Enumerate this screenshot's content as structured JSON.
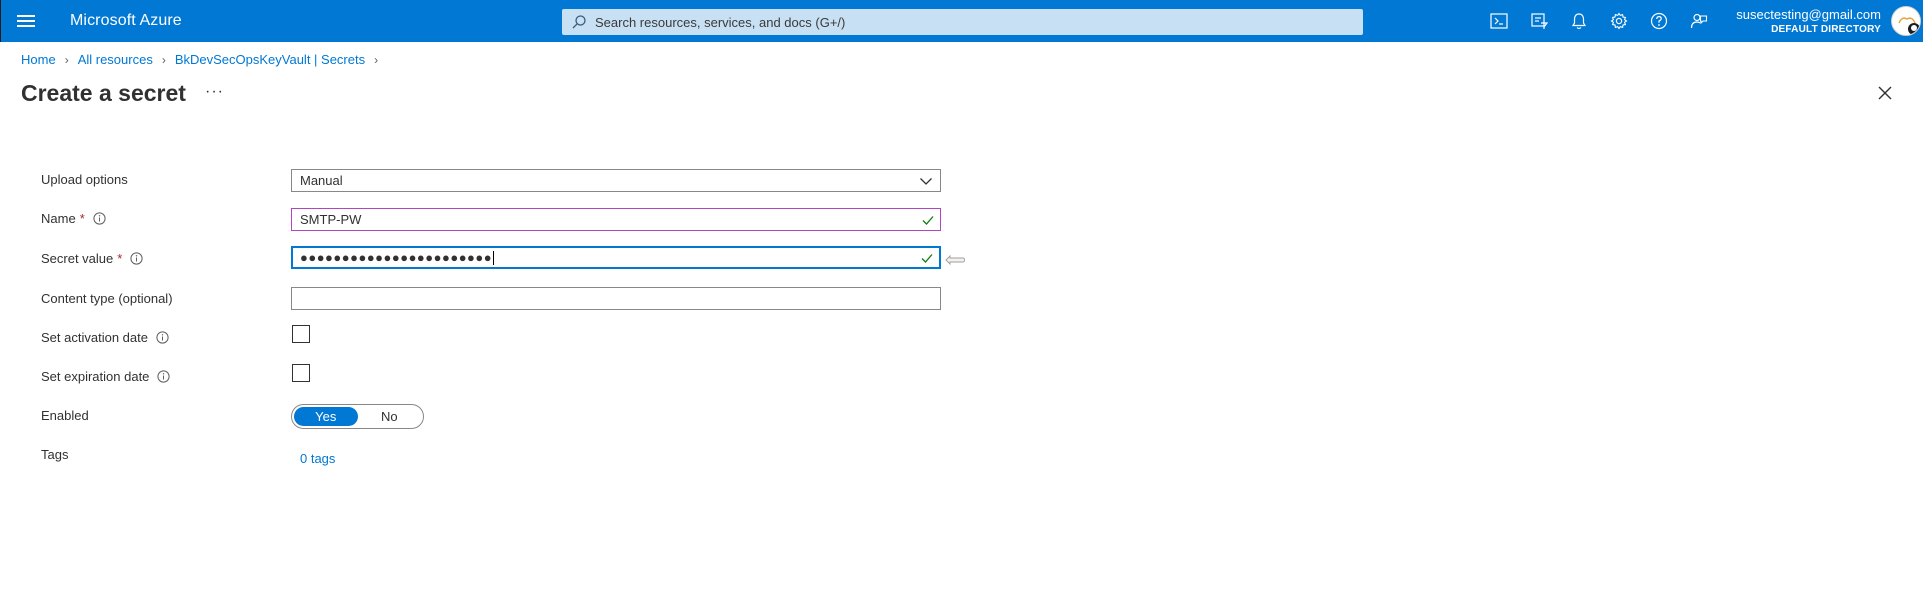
{
  "topbar": {
    "brand": "Microsoft Azure",
    "search_placeholder": "Search resources, services, and docs (G+/)",
    "icons": [
      "cloud-shell-icon",
      "directory-filter-icon",
      "notifications-icon",
      "settings-icon",
      "help-icon",
      "feedback-icon"
    ],
    "account_email": "susectesting@gmail.com",
    "account_directory": "DEFAULT DIRECTORY"
  },
  "breadcrumb": {
    "items": [
      "Home",
      "All resources",
      "BkDevSecOpsKeyVault | Secrets"
    ]
  },
  "page": {
    "title": "Create a secret",
    "more": "···"
  },
  "form": {
    "upload_options_label": "Upload options",
    "upload_options_value": "Manual",
    "name_label": "Name",
    "name_value": "SMTP-PW",
    "secret_value_label": "Secret value",
    "secret_value_masked": "●●●●●●●●●●●●●●●●●●●●●●●",
    "content_type_label": "Content type (optional)",
    "content_type_value": "",
    "activation_label": "Set activation date",
    "expiration_label": "Set expiration date",
    "enabled_label": "Enabled",
    "enabled_yes": "Yes",
    "enabled_no": "No",
    "enabled_selected": "Yes",
    "tags_label": "Tags",
    "tags_link": "0 tags",
    "required_marker": "*"
  },
  "colors": {
    "accent": "#0078d4",
    "name_border": "#b146c2",
    "valid_check": "#107c10",
    "required": "#a4262c"
  }
}
